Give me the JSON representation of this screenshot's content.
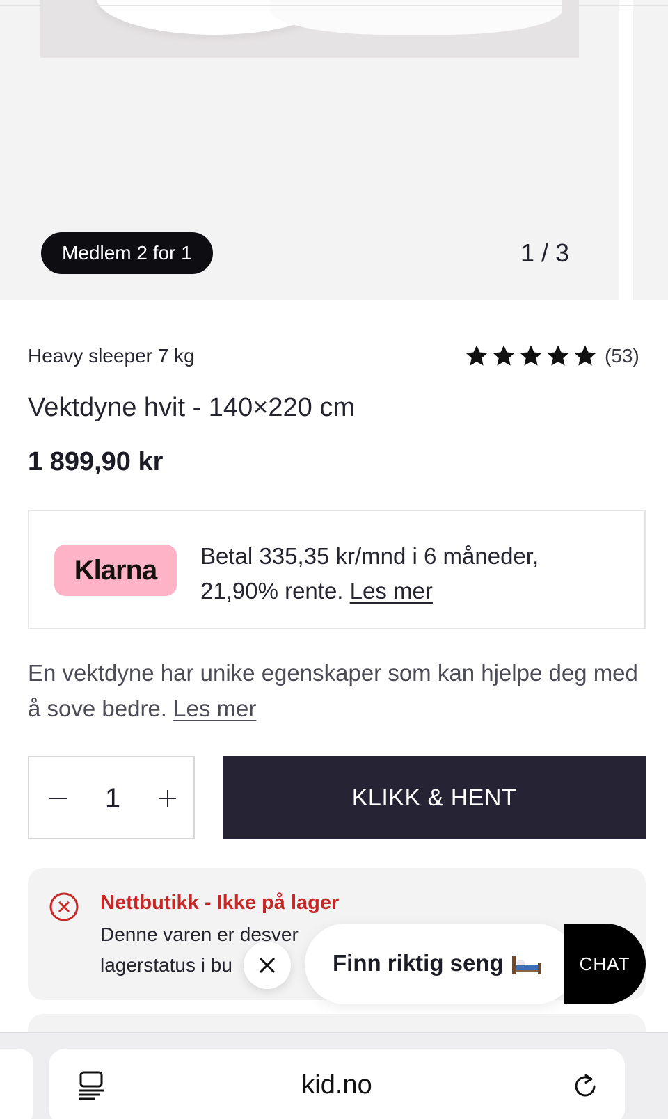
{
  "gallery": {
    "badge": "Medlem 2 for 1",
    "counter": "1 / 3"
  },
  "product": {
    "brand": "Heavy sleeper 7 kg",
    "rating_stars": 5,
    "rating_count": "(53)",
    "title": "Vektdyne hvit - 140×220 cm",
    "price": "1 899,90 kr"
  },
  "klarna": {
    "logo_text": "Klarna",
    "text": "Betal 335,35 kr/mnd i 6 måneder, 21,90% rente.",
    "link": "Les mer",
    "color": "#ffb3c7"
  },
  "description": {
    "text": "En vektdyne har unike egenskaper som kan hjelpe deg med å sove bedre.",
    "link": "Les mer"
  },
  "purchase": {
    "quantity": "1",
    "button": "KLIKK & HENT",
    "button_color": "#262335"
  },
  "stock": {
    "heading": "Nettbutikk - Ikke på lager",
    "body": "Denne varen er desver",
    "body2": "lagerstatus i bu",
    "color": "#c62828"
  },
  "chat_widget": {
    "promo": "Finn riktig seng",
    "promo_icon": "bed-icon",
    "chat_label": "CHAT"
  },
  "browser": {
    "url": "kid.no"
  }
}
